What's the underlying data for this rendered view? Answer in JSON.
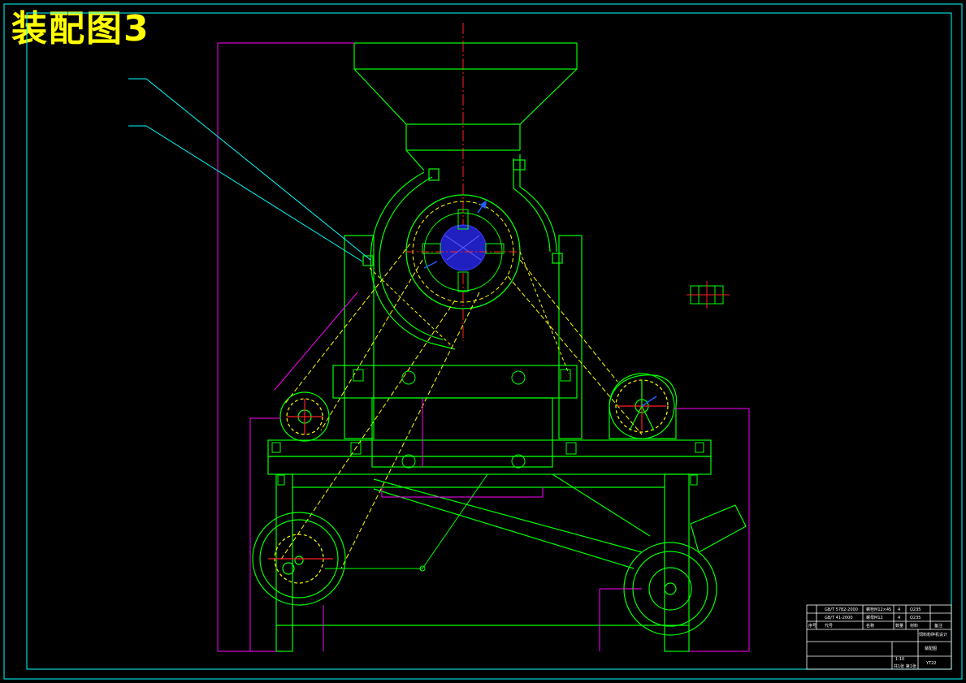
{
  "drawing": {
    "title": "装配图3"
  },
  "title_block": {
    "rows": [
      [
        "",
        "GB/T 5782-2000",
        "螺栓M12×45",
        "4",
        "Q235",
        ""
      ],
      [
        "",
        "GB/T 41-2000",
        "螺母M12",
        "4",
        "Q235",
        ""
      ]
    ],
    "header": [
      "序号",
      "代号",
      "名称",
      "数量",
      "材料",
      "备注"
    ],
    "project_name": "饲料粉碎机设计",
    "drawing_label": "装配图",
    "scale": "1:10",
    "sheet": "共1张 第1张",
    "drawing_no": "YT22"
  },
  "colors": {
    "background": "#000000",
    "frame": "#00ffff",
    "outline": "#00ff00",
    "dimension": "#ff00ff",
    "hidden": "#ffff00",
    "centerline": "#ff0000",
    "section": "#0000ff",
    "leader": "#00ffff",
    "title": "#ffff00"
  }
}
